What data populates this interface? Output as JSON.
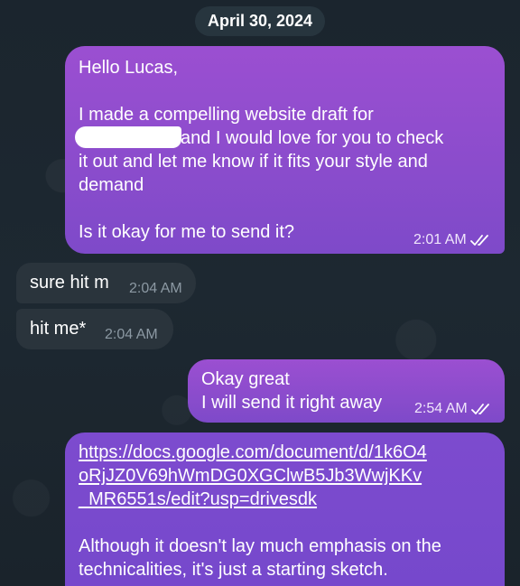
{
  "chat": {
    "date_separator": "April 30, 2024",
    "messages": [
      {
        "direction": "outgoing",
        "lines": [
          "Hello Lucas,",
          "",
          "I made a compelling website draft for",
          "and I would love for you to check",
          "it out and let me know if it fits your style and",
          "demand",
          "",
          "Is it okay for me to send it?"
        ],
        "time": "2:01 AM",
        "status": "read"
      },
      {
        "direction": "incoming",
        "text": "sure hit m",
        "time": "2:04 AM"
      },
      {
        "direction": "incoming",
        "text": "hit me*",
        "time": "2:04 AM"
      },
      {
        "direction": "outgoing",
        "lines": [
          "Okay great",
          "I will send it right away"
        ],
        "time": "2:54 AM",
        "status": "read"
      },
      {
        "direction": "outgoing",
        "link_lines": [
          "https://docs.google.com/document/d/1k6O4",
          "oRjJZ0V69hWmDG0XGClwB5Jb3WwjKKv",
          "_MR6551s/edit?usp=drivesdk"
        ],
        "lines_after": [
          "Although it doesn't lay much emphasis on the",
          "technicalities, it's just a starting sketch."
        ]
      }
    ]
  },
  "colors": {
    "background": "#1f2a33",
    "outgoing_bubble": "#8a4ccc",
    "incoming_bubble": "#2a343c",
    "read_ticks": "#ffffff"
  },
  "icons": {
    "read_status": "double-check-icon"
  }
}
